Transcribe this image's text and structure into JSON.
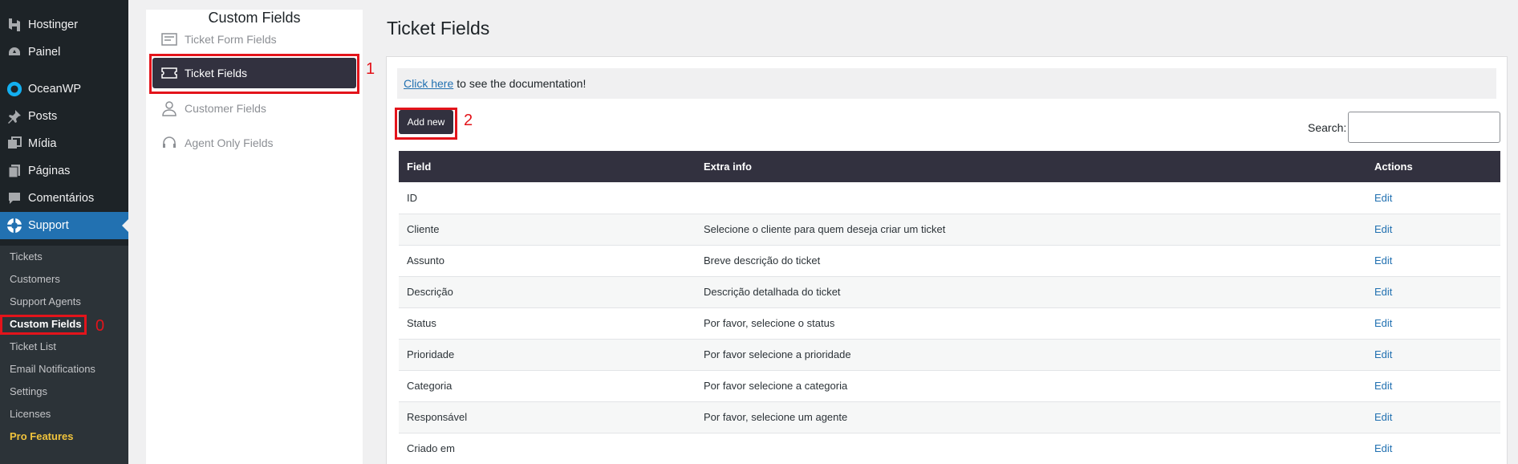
{
  "admin_menu": {
    "items": [
      {
        "label": "Hostinger",
        "icon": "hostinger-icon"
      },
      {
        "label": "Painel",
        "icon": "dashboard-icon"
      },
      {
        "label": "OceanWP",
        "icon": "oceanwp-icon"
      },
      {
        "label": "Posts",
        "icon": "pin-icon"
      },
      {
        "label": "Mídia",
        "icon": "media-icon"
      },
      {
        "label": "Páginas",
        "icon": "pages-icon"
      },
      {
        "label": "Comentários",
        "icon": "comments-icon"
      },
      {
        "label": "Support",
        "icon": "support-icon"
      }
    ],
    "submenu": [
      "Tickets",
      "Customers",
      "Support Agents",
      "Custom Fields",
      "Ticket List",
      "Email Notifications",
      "Settings",
      "Licenses",
      "Pro Features"
    ]
  },
  "custom_fields_panel": {
    "title": "Custom Fields",
    "items": [
      "Ticket Form Fields",
      "Ticket Fields",
      "Customer Fields",
      "Agent Only Fields"
    ]
  },
  "main": {
    "title": "Ticket Fields",
    "doc_link": "Click here",
    "doc_text": "to see the documentation!",
    "add_new": "Add new",
    "search_label": "Search:",
    "search_value": ""
  },
  "table": {
    "headers": [
      "Field",
      "Extra info",
      "Actions"
    ],
    "rows": [
      {
        "field": "ID",
        "extra": "",
        "action": "Edit"
      },
      {
        "field": "Cliente",
        "extra": "Selecione o cliente para quem deseja criar um ticket",
        "action": "Edit"
      },
      {
        "field": "Assunto",
        "extra": "Breve descrição do ticket",
        "action": "Edit"
      },
      {
        "field": "Descrição",
        "extra": "Descrição detalhada do ticket",
        "action": "Edit"
      },
      {
        "field": "Status",
        "extra": "Por favor, selecione o status",
        "action": "Edit"
      },
      {
        "field": "Prioridade",
        "extra": "Por favor selecione a prioridade",
        "action": "Edit"
      },
      {
        "field": "Categoria",
        "extra": "Por favor selecione a categoria",
        "action": "Edit"
      },
      {
        "field": "Responsável",
        "extra": "Por favor, selecione um agente",
        "action": "Edit"
      },
      {
        "field": "Criado em",
        "extra": "",
        "action": "Edit"
      }
    ]
  },
  "annotations": [
    "0",
    "1",
    "2"
  ],
  "colors": {
    "accent": "#2271b1",
    "dark": "#32313f",
    "sidebar": "#1d2327",
    "marker": "#e3141b",
    "pro": "#f0c33c"
  }
}
